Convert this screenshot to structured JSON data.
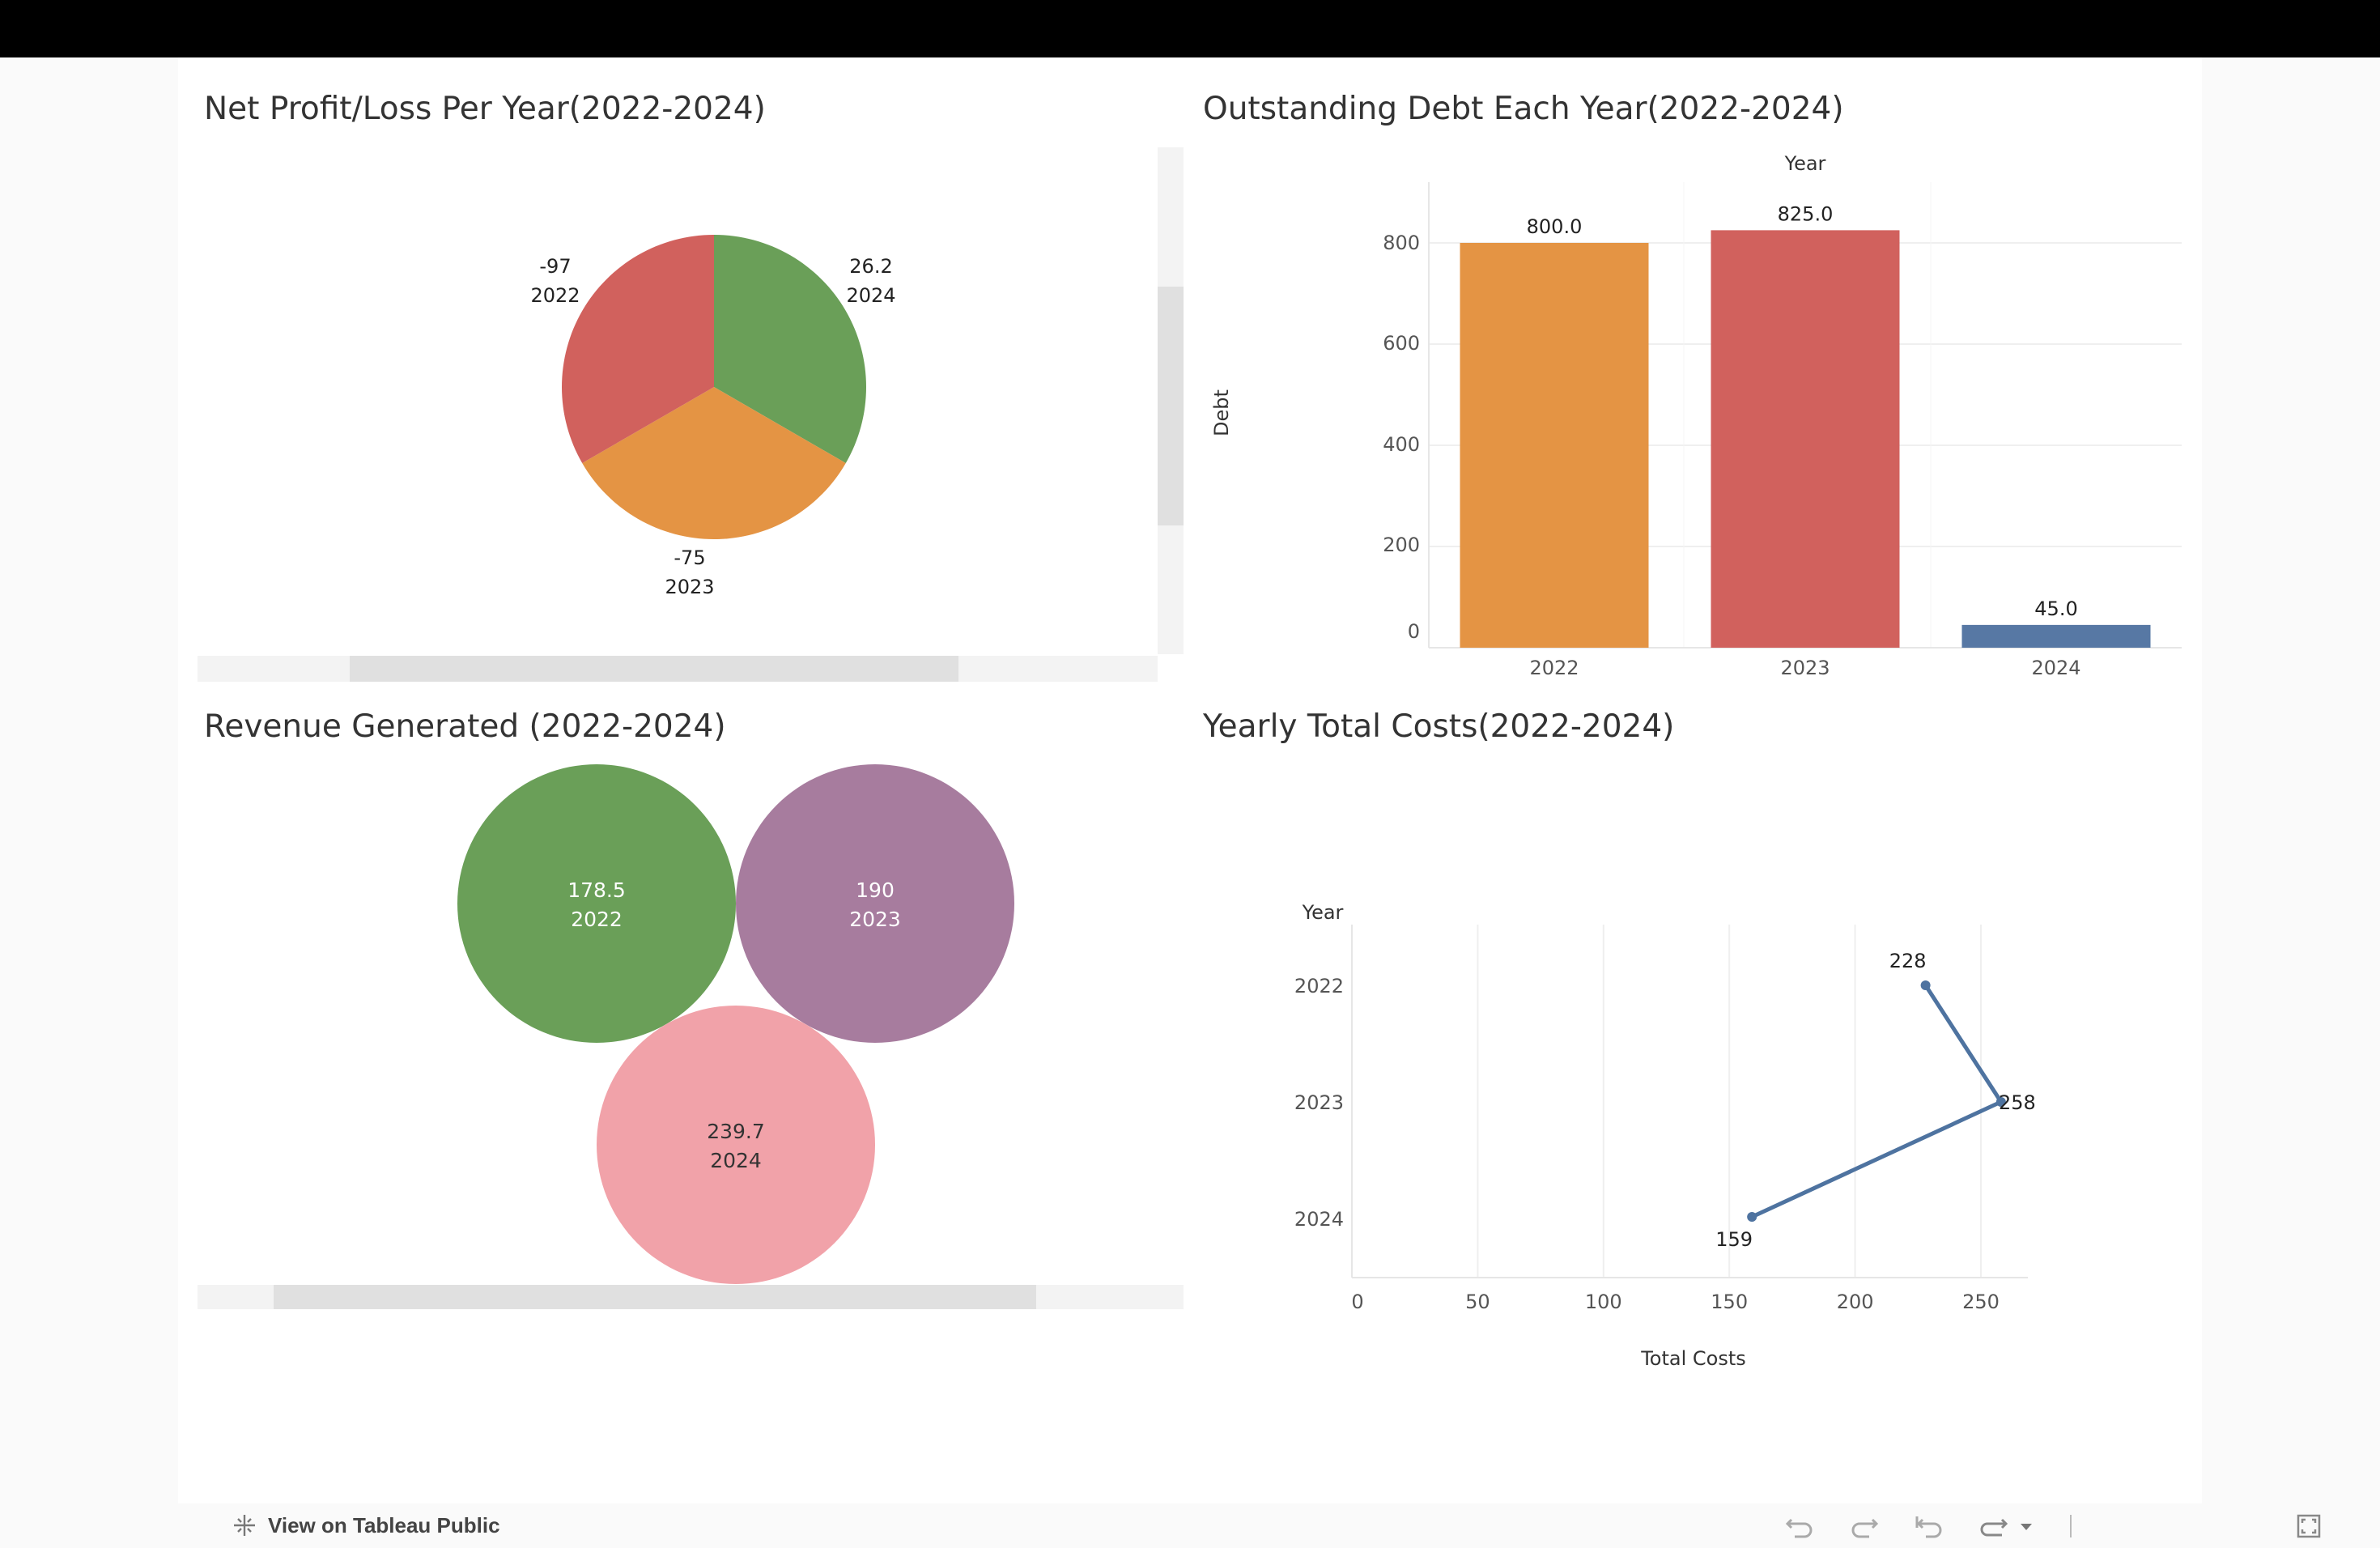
{
  "footer": {
    "link_label": "View on Tableau Public"
  },
  "chart_data": [
    {
      "type": "pie",
      "title": "Net Profit/Loss  Per Year(2022-2024)",
      "slices": [
        {
          "label": "2024",
          "value": 26.2,
          "value_label": "26.2",
          "color": "#6a9f58"
        },
        {
          "label": "2023",
          "value": -75,
          "value_label": "-75",
          "color": "#e49444"
        },
        {
          "label": "2022",
          "value": -97,
          "value_label": "-97",
          "color": "#d1615d"
        }
      ]
    },
    {
      "type": "bar",
      "title": "Outstanding Debt Each Year(2022-2024)",
      "xlabel": "Year",
      "ylabel": "Debt",
      "categories": [
        "2022",
        "2023",
        "2024"
      ],
      "values": [
        800.0,
        825.0,
        45.0
      ],
      "value_labels": [
        "800.0",
        "825.0",
        "45.0"
      ],
      "colors": [
        "#e49444",
        "#d1615d",
        "#5778a4"
      ],
      "yticks": [
        "0",
        "200",
        "400",
        "600",
        "800"
      ],
      "ylim": [
        0,
        900
      ],
      "grid": true
    },
    {
      "type": "bubble",
      "title": "Revenue Generated (2022-2024)",
      "bubbles": [
        {
          "label": "2022",
          "value": 178.5,
          "value_label": "178.5",
          "color": "#6a9f58",
          "text_color": "#ffffff"
        },
        {
          "label": "2023",
          "value": 190,
          "value_label": "190",
          "color": "#a77c9e",
          "text_color": "#ffffff"
        },
        {
          "label": "2024",
          "value": 239.7,
          "value_label": "239.7",
          "color": "#f1a2a9",
          "text_color": "#333333"
        }
      ]
    },
    {
      "type": "line",
      "title": "Yearly Total Costs(2022-2024)",
      "xlabel": "Total Costs",
      "ylabel": "Year",
      "categories": [
        "2022",
        "2023",
        "2024"
      ],
      "values": [
        228,
        258,
        159
      ],
      "value_labels": [
        "228",
        "258",
        "159"
      ],
      "xticks": [
        "0",
        "50",
        "100",
        "150",
        "200",
        "250"
      ],
      "xlim": [
        0,
        270
      ],
      "color": "#4e73a0",
      "grid": true
    }
  ]
}
